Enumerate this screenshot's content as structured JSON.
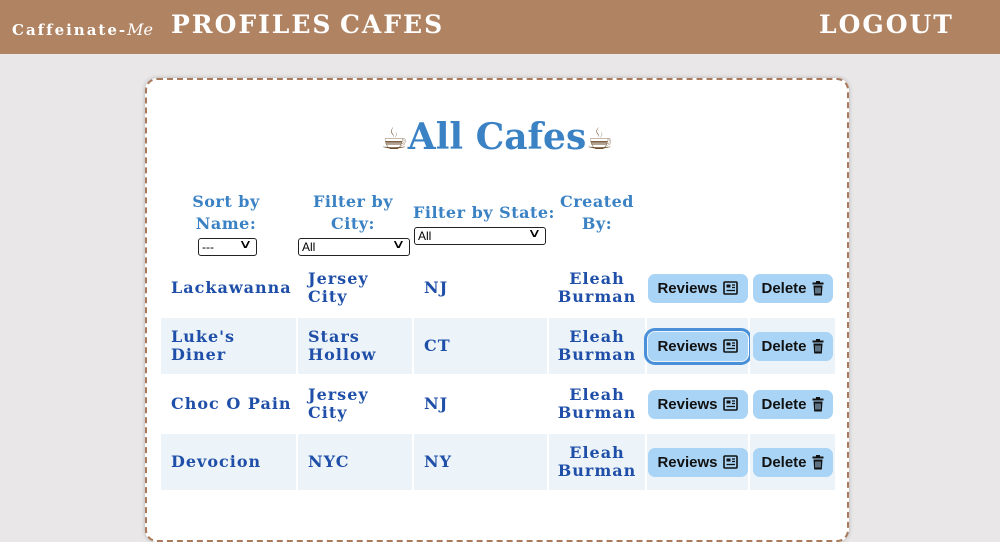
{
  "nav": {
    "brand_main": "Caffeinate-",
    "brand_script": "Me",
    "profiles": "PROFILES",
    "cafes": "CAFES",
    "logout": "LOGOUT"
  },
  "page": {
    "title": "All Cafes",
    "title_icon": "coffee-cup-icon"
  },
  "controls": {
    "sort_label_1": "Sort by",
    "sort_label_2": "Name:",
    "sort_value": "---",
    "city_label_1": "Filter by",
    "city_label_2": "City:",
    "city_value": "All",
    "state_label": "Filter by State:",
    "state_value": "All",
    "created_label_1": "Created",
    "created_label_2": "By:"
  },
  "buttons": {
    "reviews": "Reviews",
    "delete": "Delete",
    "reviews_icon": "newspaper-icon",
    "delete_icon": "trash-icon"
  },
  "cafes": [
    {
      "name": "Lackawanna",
      "city_1": "Jersey City",
      "city_2": "",
      "state": "NJ",
      "creator_1": "Eleah",
      "creator_2": "Burman"
    },
    {
      "name": "Luke's Diner",
      "city_1": "Stars",
      "city_2": "Hollow",
      "state": "CT",
      "creator_1": "Eleah",
      "creator_2": "Burman"
    },
    {
      "name": "Choc O Pain",
      "city_1": "Jersey City",
      "city_2": "",
      "state": "NJ",
      "creator_1": "Eleah",
      "creator_2": "Burman"
    },
    {
      "name": "Devocion",
      "city_1": "NYC",
      "city_2": "",
      "state": "NY",
      "creator_1": "Eleah",
      "creator_2": "Burman"
    }
  ],
  "colors": {
    "navbar": "#b08463",
    "accent_blue": "#3b82c4",
    "cell_text": "#1f4fa8",
    "button": "#a9d4f5",
    "row_shade": "#edf4f9"
  }
}
